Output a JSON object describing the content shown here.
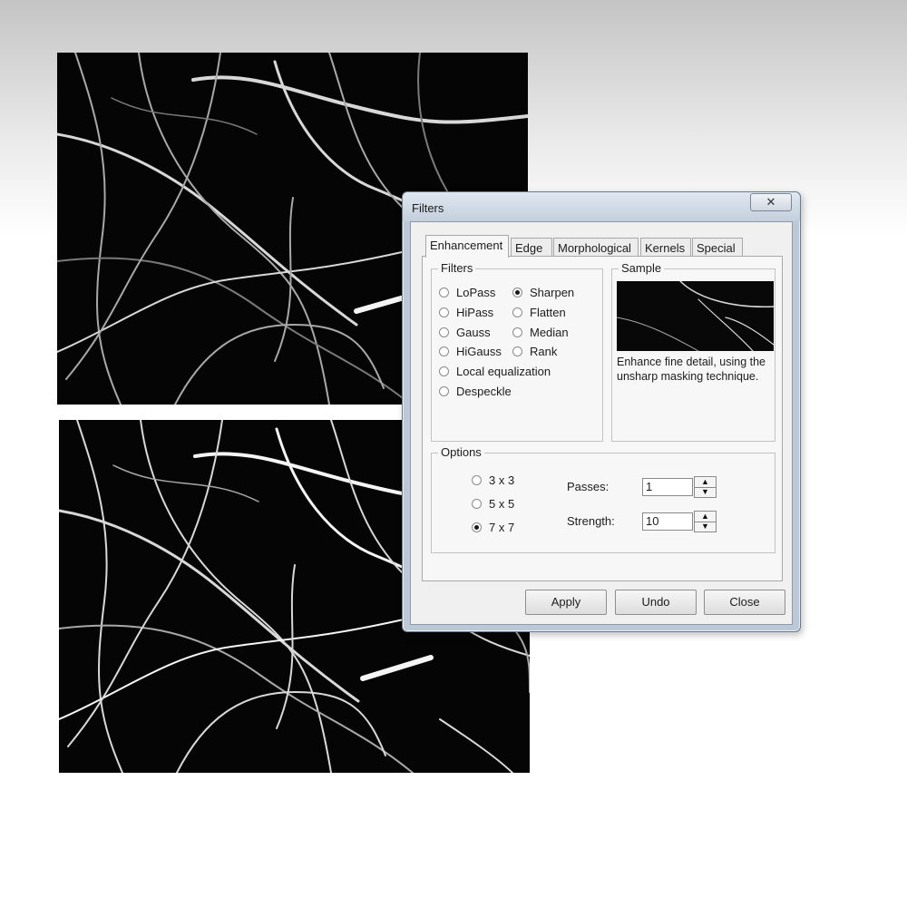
{
  "dialog": {
    "title": "Filters",
    "close_glyph": "✕",
    "tabs": [
      {
        "label": "Enhancement",
        "active": true
      },
      {
        "label": "Edge",
        "active": false
      },
      {
        "label": "Morphological",
        "active": false
      },
      {
        "label": "Kernels",
        "active": false
      },
      {
        "label": "Special",
        "active": false
      }
    ],
    "filters_group": {
      "label": "Filters",
      "options": [
        "LoPass",
        "Sharpen",
        "HiPass",
        "Flatten",
        "Gauss",
        "Median",
        "HiGauss",
        "Rank",
        "Local equalization",
        "Despeckle"
      ],
      "selected": "Sharpen"
    },
    "sample_group": {
      "label": "Sample",
      "description": "Enhance fine detail, using the unsharp masking technique."
    },
    "options_group": {
      "label": "Options",
      "sizes": [
        "3 x 3",
        "5 x 5",
        "7 x 7"
      ],
      "selected_size": "7 x 7",
      "passes_label": "Passes:",
      "passes_value": "1",
      "strength_label": "Strength:",
      "strength_value": "10"
    },
    "buttons": {
      "apply": "Apply",
      "undo": "Undo",
      "close": "Close"
    }
  },
  "colors": {
    "window_frame": "#bcc8d6",
    "client_bg": "#f0f0f0",
    "micrograph_bg": "#050505"
  },
  "icons": [
    "close-icon",
    "spin-up-icon",
    "spin-down-icon"
  ]
}
